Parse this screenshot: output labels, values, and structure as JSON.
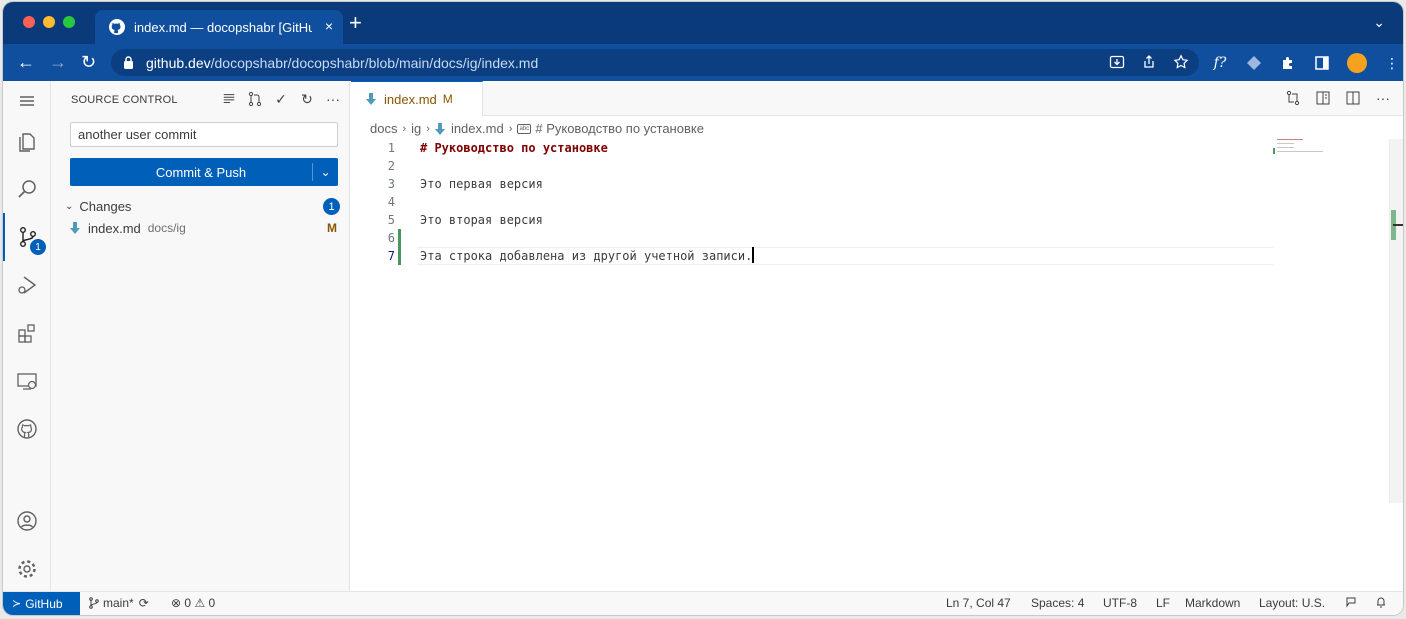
{
  "browser": {
    "tab_title": "index.md — docopshabr [GitHub]",
    "close": "×",
    "new_tab": "+",
    "url_host": "github.dev",
    "url_path": "/docopshabr/docopshabr/blob/main/docs/ig/index.md",
    "ext_f": "f?"
  },
  "activity": {
    "scm_badge": "1"
  },
  "sidebar": {
    "title": "SOURCE CONTROL",
    "commit_message": "another user commit",
    "commit_button": "Commit & Push",
    "changes_label": "Changes",
    "changes_count": "1",
    "file": {
      "name": "index.md",
      "dir": "docs/ig",
      "status": "M"
    }
  },
  "editor": {
    "tab_name": "index.md",
    "tab_status": "M",
    "breadcrumb": [
      "docs",
      "ig",
      "index.md",
      "# Руководство по установке"
    ],
    "lines": [
      {
        "n": "1",
        "text": "# Руководство по установке"
      },
      {
        "n": "2",
        "text": ""
      },
      {
        "n": "3",
        "text": "Это первая версия"
      },
      {
        "n": "4",
        "text": ""
      },
      {
        "n": "5",
        "text": "Это вторая версия"
      },
      {
        "n": "6",
        "text": ""
      },
      {
        "n": "7",
        "text": "Эта строка добавлена из другой учетной записи."
      }
    ]
  },
  "status": {
    "remote": "GitHub",
    "branch": "main*",
    "errors": "0",
    "warnings": "0",
    "position": "Ln 7, Col 47",
    "spaces": "Spaces: 4",
    "encoding": "UTF-8",
    "eol": "LF",
    "language": "Markdown",
    "layout": "Layout: U.S."
  },
  "colors": {
    "accent": "#005fb8",
    "browser_frame": "#0b3a7a",
    "heading": "#800000",
    "modified": "#895503",
    "added_gutter": "#48985d"
  }
}
